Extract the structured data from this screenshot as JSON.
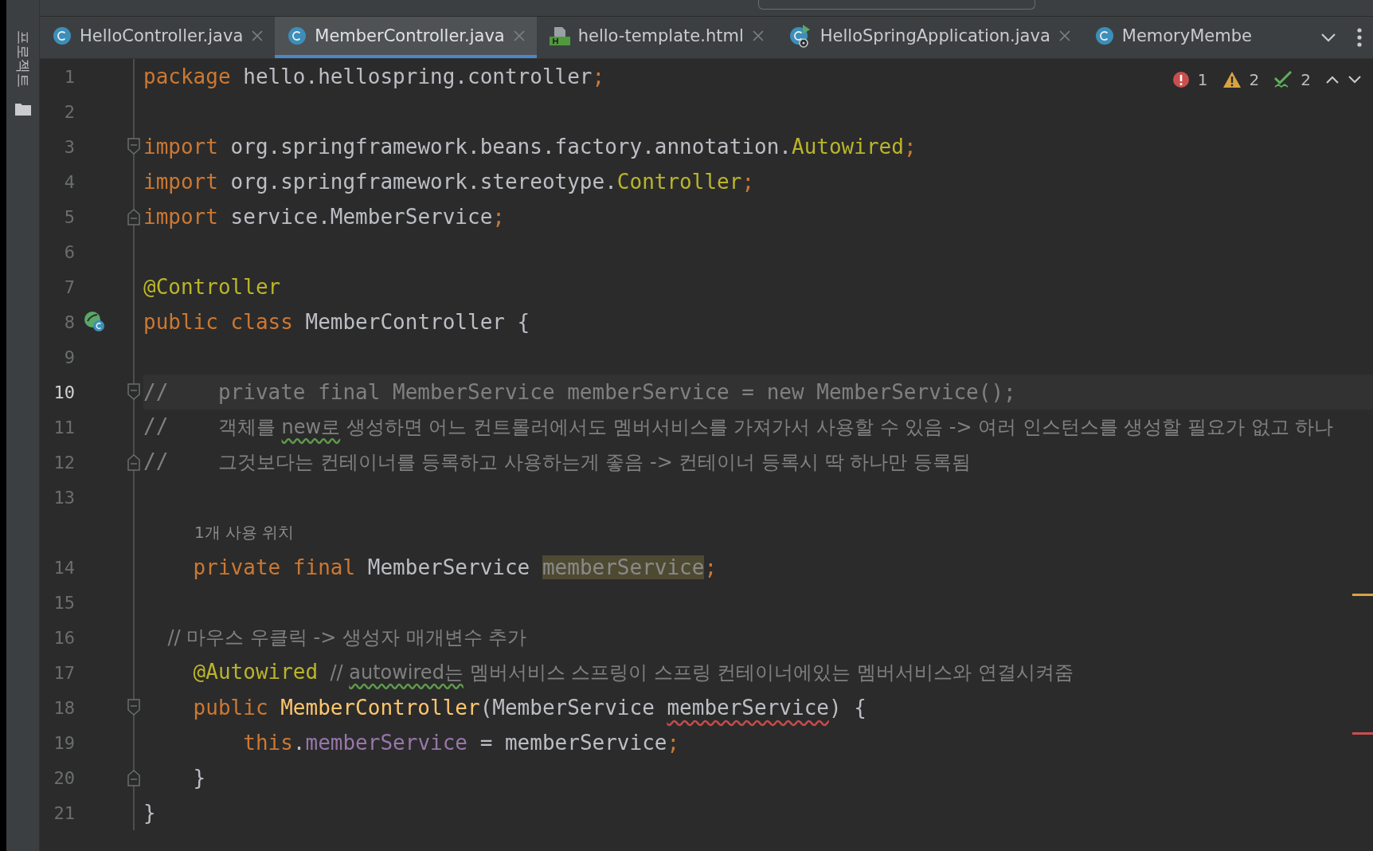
{
  "sidebar": {
    "tool_window": "프로젝트"
  },
  "tabs": [
    {
      "label": "HelloController.java",
      "kind": "class",
      "selected": false,
      "closable": true
    },
    {
      "label": "MemberController.java",
      "kind": "class",
      "selected": true,
      "closable": true
    },
    {
      "label": "hello-template.html",
      "kind": "html",
      "selected": false,
      "closable": true
    },
    {
      "label": "HelloSpringApplication.java",
      "kind": "spring",
      "selected": false,
      "closable": true
    },
    {
      "label": "MemoryMembe",
      "kind": "class",
      "selected": false,
      "closable": false
    }
  ],
  "problems": {
    "errors": "1",
    "warnings": "2",
    "weak_warnings": "2"
  },
  "lines": [
    {
      "kind": "code",
      "number": "1",
      "tokens": [
        {
          "kind": "kw",
          "text": "package"
        },
        {
          "kind": "plain",
          "text": " hello.hellospring.controller"
        },
        {
          "kind": "kw",
          "text": ";"
        }
      ]
    },
    {
      "kind": "code",
      "number": "2"
    },
    {
      "kind": "code",
      "number": "3",
      "fold_start": true,
      "tokens": [
        {
          "kind": "kw",
          "text": "import"
        },
        {
          "kind": "plain",
          "text": " org.springframework.beans.factory.annotation."
        },
        {
          "kind": "ann",
          "text": "Autowired"
        },
        {
          "kind": "kw",
          "text": ";"
        }
      ]
    },
    {
      "kind": "code",
      "number": "4",
      "tokens": [
        {
          "kind": "kw",
          "text": "import"
        },
        {
          "kind": "plain",
          "text": " org.springframework.stereotype."
        },
        {
          "kind": "ann",
          "text": "Controller"
        },
        {
          "kind": "kw",
          "text": ";"
        }
      ]
    },
    {
      "kind": "code",
      "number": "5",
      "fold_end": true,
      "tokens": [
        {
          "kind": "kw",
          "text": "import"
        },
        {
          "kind": "plain",
          "text": " service.MemberService"
        },
        {
          "kind": "kw",
          "text": ";"
        }
      ]
    },
    {
      "kind": "code",
      "number": "6"
    },
    {
      "kind": "code",
      "number": "7",
      "tokens": [
        {
          "kind": "ann",
          "text": "@Controller"
        }
      ]
    },
    {
      "kind": "code",
      "number": "8",
      "bean": true,
      "tokens": [
        {
          "kind": "kw",
          "text": "public class"
        },
        {
          "kind": "plain",
          "text": " MemberController {"
        }
      ]
    },
    {
      "kind": "code",
      "number": "9"
    },
    {
      "kind": "code",
      "number": "10",
      "current": true,
      "fold_start": true,
      "tokens": [
        {
          "kind": "comment",
          "text": "//    private final MemberService memberService = new MemberService();"
        }
      ]
    },
    {
      "kind": "code",
      "number": "11",
      "tokens": [
        {
          "kind": "comment",
          "text": "//    "
        },
        {
          "kind": "note",
          "text": "객체를 "
        },
        {
          "kind": "note",
          "text": "new로",
          "warning": true
        },
        {
          "kind": "note",
          "text": " 생성하면 어느 컨트롤러에서도 멤버서비스를 가져가서 사용할 수 있음 -> 여러 인스턴스를 생성할 필요가 없고 하나"
        }
      ]
    },
    {
      "kind": "code",
      "number": "12",
      "fold_end": true,
      "tokens": [
        {
          "kind": "comment",
          "text": "//    "
        },
        {
          "kind": "note",
          "text": "그것보다는 컨테이너를 등록하고 사용하는게 좋음 -> 컨테이너 등록시 딱 하나만 등록됨"
        }
      ]
    },
    {
      "kind": "code",
      "number": "13"
    },
    {
      "kind": "hint",
      "text": "1개 사용 위치"
    },
    {
      "kind": "code",
      "number": "14",
      "tokens": [
        {
          "kind": "kw",
          "text": "    private final"
        },
        {
          "kind": "plain",
          "text": " MemberService "
        },
        {
          "kind": "unused",
          "text": "memberService"
        },
        {
          "kind": "kw",
          "text": ";"
        }
      ]
    },
    {
      "kind": "code",
      "number": "15"
    },
    {
      "kind": "code",
      "number": "16",
      "tokens": [
        {
          "kind": "note",
          "text": "    // 마우스 우클릭 -> 생성자 매개변수 추가"
        }
      ]
    },
    {
      "kind": "code",
      "number": "17",
      "tokens": [
        {
          "kind": "ann",
          "text": "    @Autowired"
        },
        {
          "kind": "note",
          "text": "  // "
        },
        {
          "kind": "note",
          "text": "autowired는",
          "warning": true
        },
        {
          "kind": "note",
          "text": " 멤버서비스 스프링이 스프링 컨테이너에있는 멤버서비스와 연결시켜줌"
        }
      ]
    },
    {
      "kind": "code",
      "number": "18",
      "fold_start": true,
      "tokens": [
        {
          "kind": "kw",
          "text": "    public "
        },
        {
          "kind": "method",
          "text": "MemberController"
        },
        {
          "kind": "plain",
          "text": "(MemberService "
        },
        {
          "kind": "plain",
          "text": "memberService",
          "error": true
        },
        {
          "kind": "plain",
          "text": ") {"
        }
      ]
    },
    {
      "kind": "code",
      "number": "19",
      "tokens": [
        {
          "kind": "kw",
          "text": "        this"
        },
        {
          "kind": "plain",
          "text": "."
        },
        {
          "kind": "field",
          "text": "memberService"
        },
        {
          "kind": "plain",
          "text": " = memberService"
        },
        {
          "kind": "kw",
          "text": ";"
        }
      ]
    },
    {
      "kind": "code",
      "number": "20",
      "fold_end": true,
      "tokens": [
        {
          "kind": "plain",
          "text": "    }"
        }
      ]
    },
    {
      "kind": "code",
      "number": "21",
      "tokens": [
        {
          "kind": "plain",
          "text": "}"
        }
      ]
    }
  ]
}
